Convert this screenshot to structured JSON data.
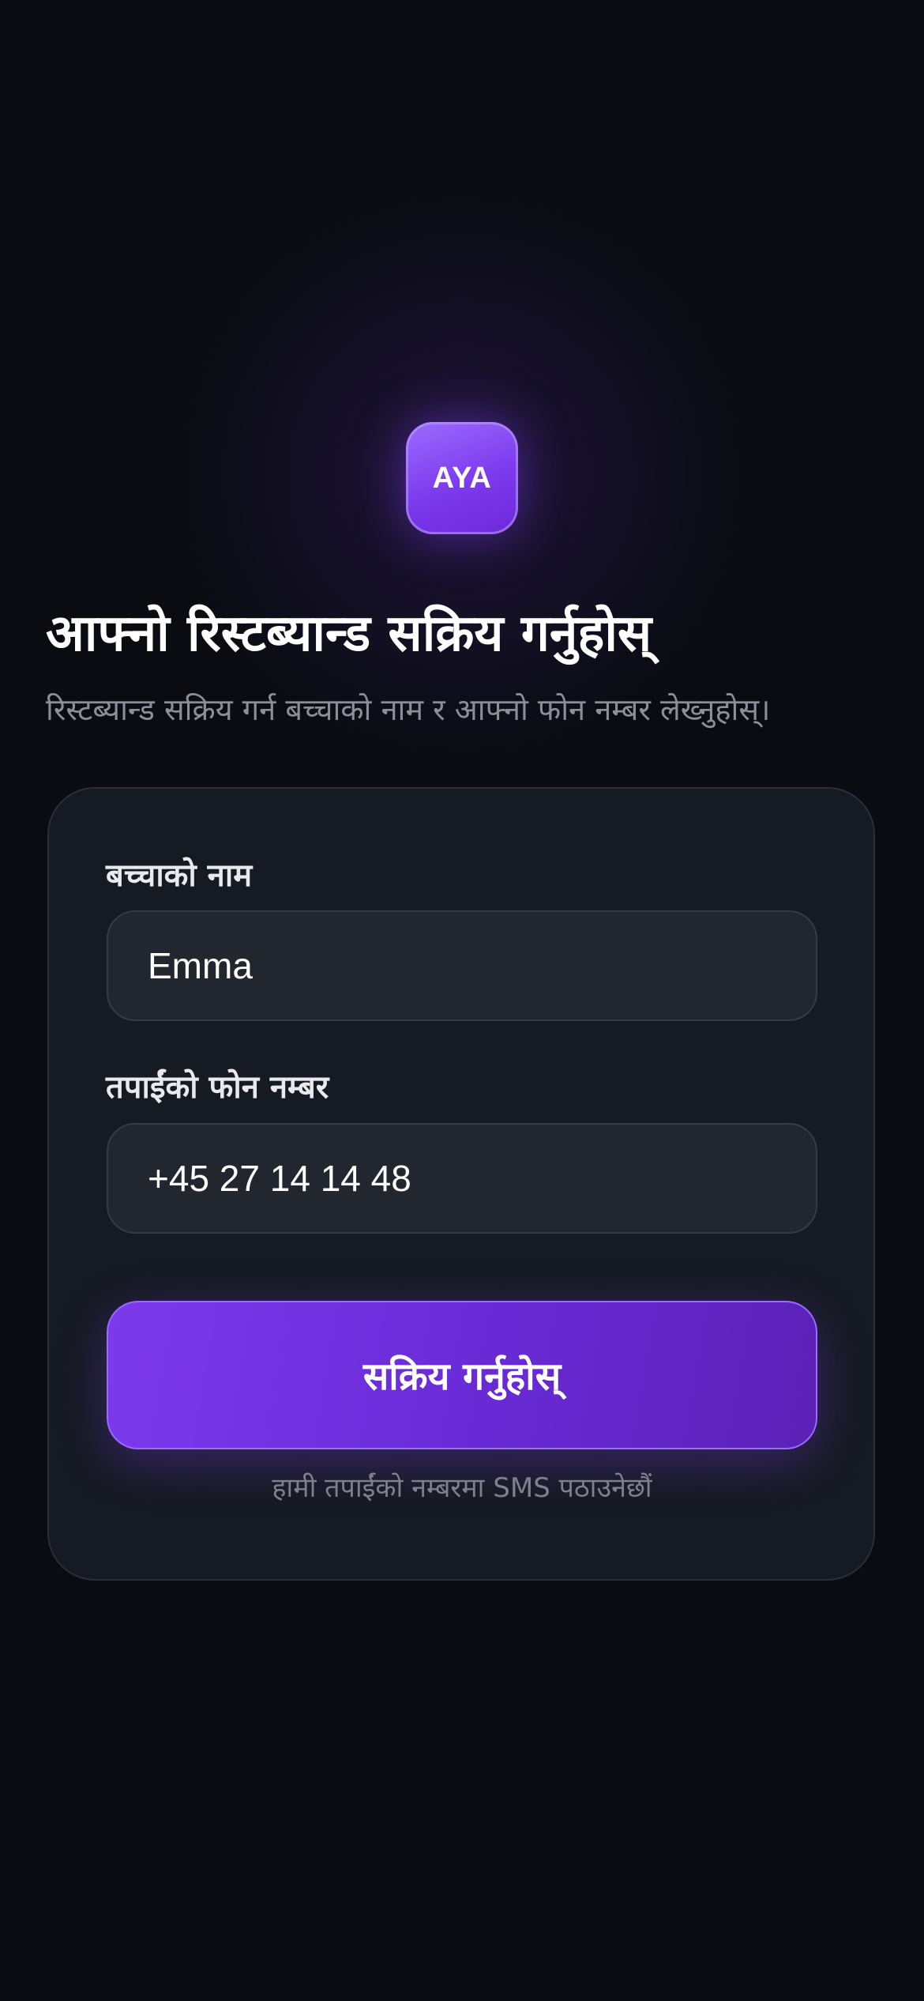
{
  "app": {
    "logo_text": "AYA"
  },
  "header": {
    "title": "आफ्नो रिस्टब्यान्ड सक्रिय गर्नुहोस्",
    "subtitle": "रिस्टब्यान्ड सक्रिय गर्न बच्चाको नाम र आफ्नो फोन नम्बर लेख्नुहोस्।"
  },
  "form": {
    "child_name_label": "बच्चाको नाम",
    "child_name_value": "Emma",
    "phone_label": "तपाईंको फोन नम्बर",
    "phone_value": "+45 27 14 14 48",
    "submit_label": "सक्रिय गर्नुहोस्",
    "sms_hint": "हामी तपाईंको नम्बरमा SMS पठाउनेछौं"
  },
  "colors": {
    "background": "#0a0c12",
    "card": "#161a22",
    "accent": "#7c3aed"
  }
}
